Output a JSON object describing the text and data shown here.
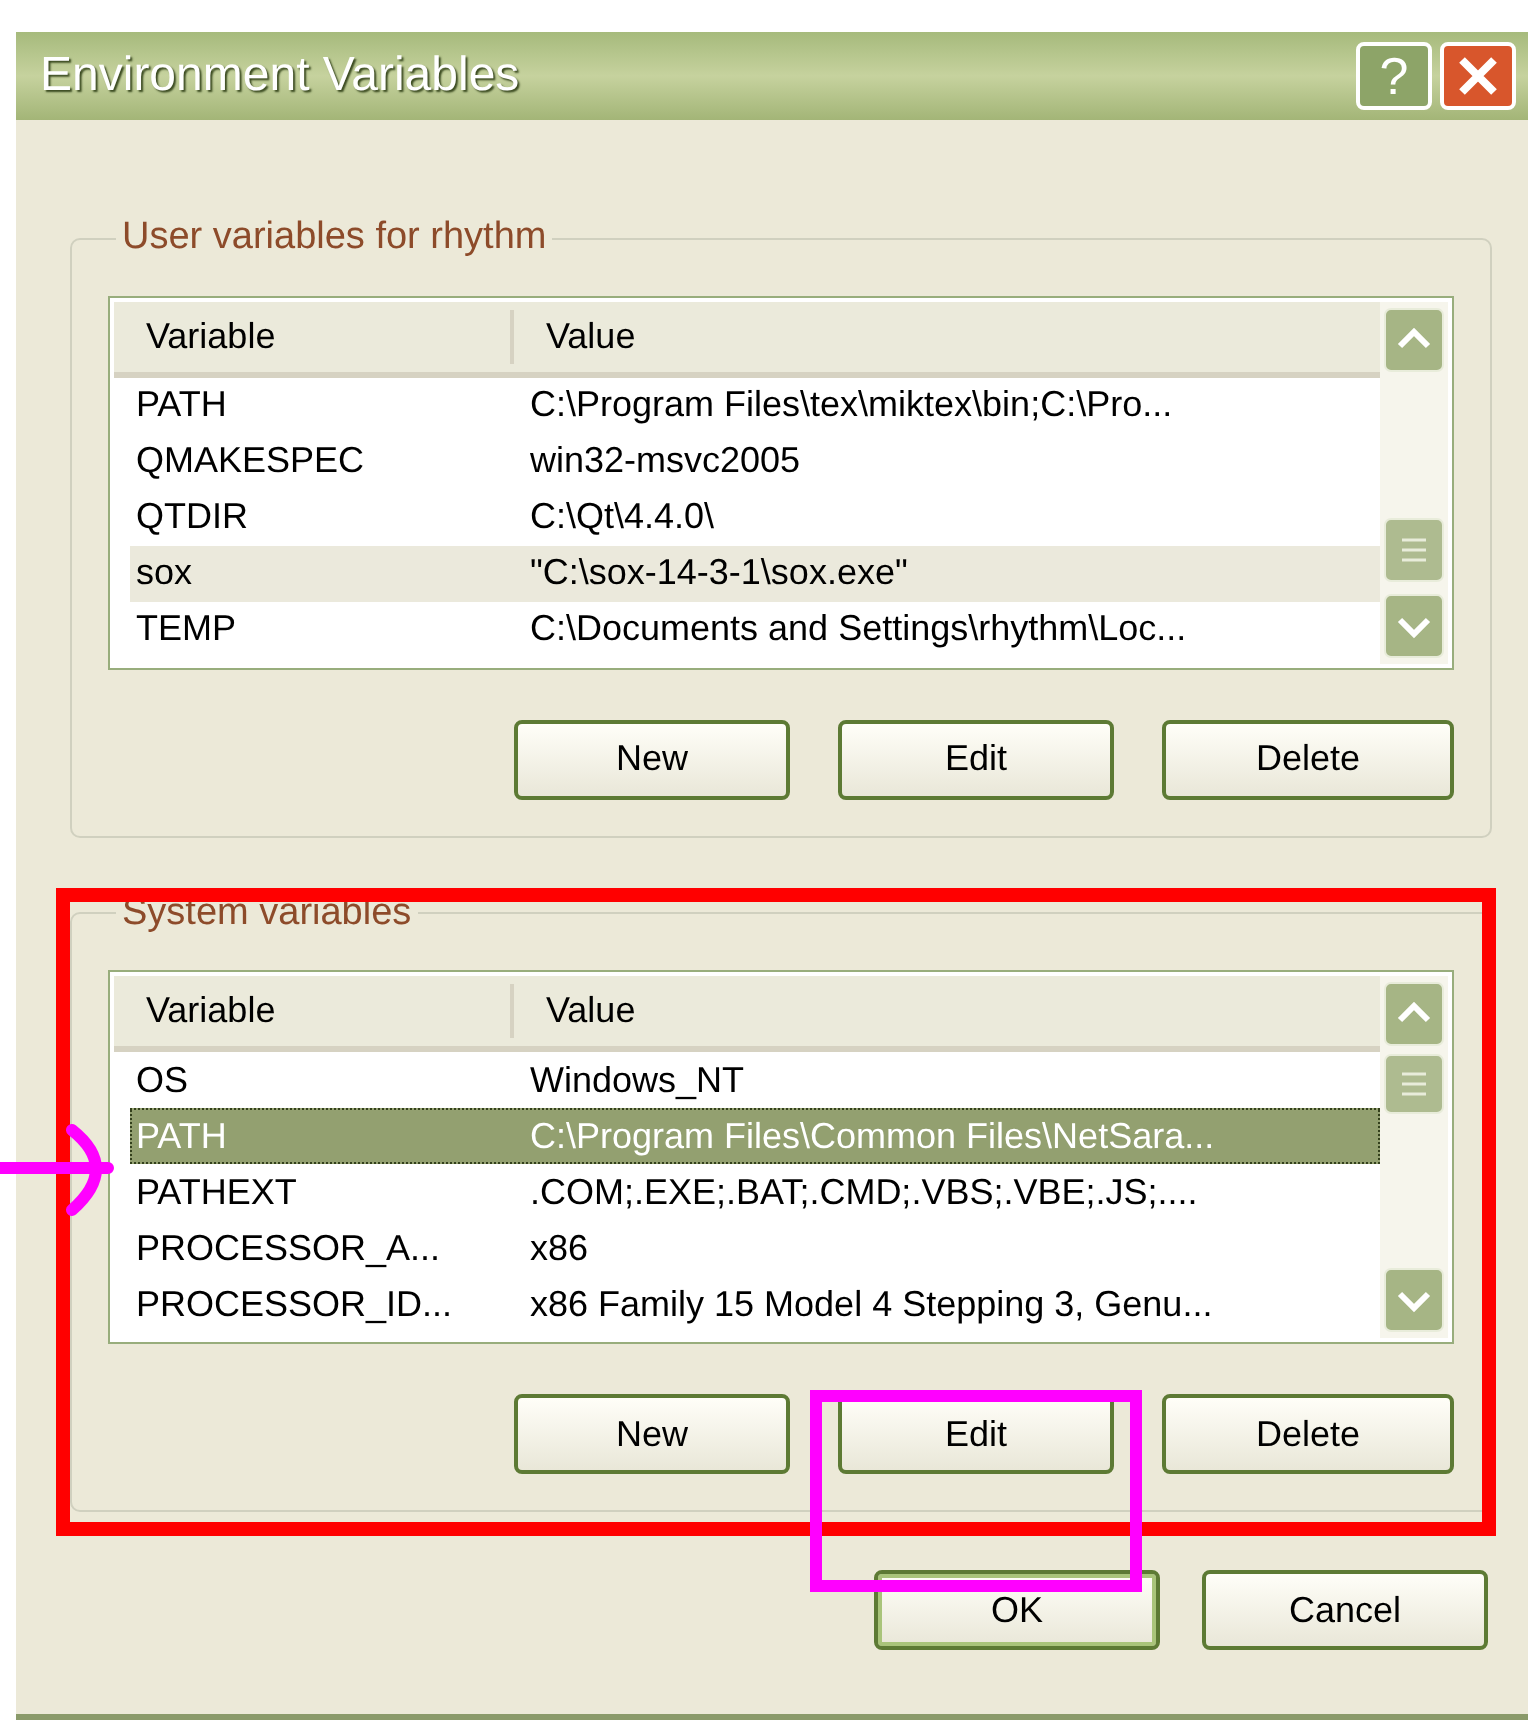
{
  "window": {
    "title": "Environment Variables",
    "help_label": "?"
  },
  "user_variables": {
    "title": "User variables for rhythm",
    "focused": false,
    "columns": [
      "Variable",
      "Value"
    ],
    "rows": [
      {
        "variable": "PATH",
        "value": "C:\\Program Files\\tex\\miktex\\bin;C:\\Pro...",
        "selected": false
      },
      {
        "variable": "QMAKESPEC",
        "value": "win32-msvc2005",
        "selected": false
      },
      {
        "variable": "QTDIR",
        "value": "C:\\Qt\\4.4.0\\",
        "selected": false
      },
      {
        "variable": "sox",
        "value": "\"C:\\sox-14-3-1\\sox.exe\"",
        "selected": true
      },
      {
        "variable": "TEMP",
        "value": "C:\\Documents and Settings\\rhythm\\Loc...",
        "selected": false
      }
    ],
    "buttons": [
      "New",
      "Edit",
      "Delete"
    ]
  },
  "system_variables": {
    "title": "System variables",
    "focused": true,
    "columns": [
      "Variable",
      "Value"
    ],
    "rows": [
      {
        "variable": "OS",
        "value": "Windows_NT",
        "selected": false
      },
      {
        "variable": "PATH",
        "value": "C:\\Program Files\\Common Files\\NetSara...",
        "selected": true
      },
      {
        "variable": "PATHEXT",
        "value": ".COM;.EXE;.BAT;.CMD;.VBS;.VBE;.JS;....",
        "selected": false
      },
      {
        "variable": "PROCESSOR_A...",
        "value": "x86",
        "selected": false
      },
      {
        "variable": "PROCESSOR_ID...",
        "value": "x86 Family 15 Model 4 Stepping 3, Genu...",
        "selected": false
      }
    ],
    "buttons": [
      "New",
      "Edit",
      "Delete"
    ]
  },
  "dialog_buttons": [
    {
      "label": "OK",
      "default": true
    },
    {
      "label": "Cancel",
      "default": false
    }
  ],
  "annotations": [
    {
      "kind": "frame",
      "color": "#ff0000"
    },
    {
      "kind": "frame",
      "color": "#ff00ff"
    },
    {
      "kind": "arrow",
      "color": "#ff00ff"
    }
  ]
}
